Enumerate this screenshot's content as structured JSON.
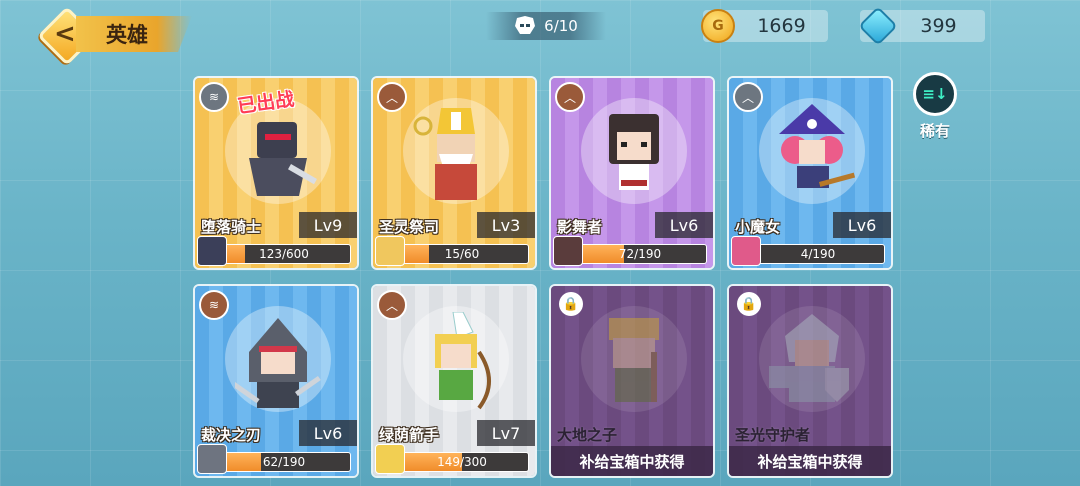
{
  "header": {
    "title": "英雄",
    "hero_count": "6/10"
  },
  "currency": {
    "coins": "1669",
    "coin_symbol": "G",
    "gems": "399"
  },
  "filter": {
    "label": "稀有"
  },
  "heroes": [
    {
      "name": "堕落骑士",
      "level": "Lv9",
      "progress_text": "123/600",
      "progress": 0.205,
      "tag": "已出战",
      "color": "#f5c152"
    },
    {
      "name": "圣灵祭司",
      "level": "Lv3",
      "progress_text": "15/60",
      "progress": 0.25,
      "color": "#f5c152"
    },
    {
      "name": "影舞者",
      "level": "Lv6",
      "progress_text": "72/190",
      "progress": 0.379,
      "color": "#b784e0"
    },
    {
      "name": "小魔女",
      "level": "Lv6",
      "progress_text": "4/190",
      "progress": 0.021,
      "color": "#5aa9e6"
    },
    {
      "name": "裁决之刃",
      "level": "Lv6",
      "progress_text": "62/190",
      "progress": 0.326,
      "color": "#5aa9e6"
    },
    {
      "name": "绿荫箭手",
      "level": "Lv7",
      "progress_text": "149/300",
      "progress": 0.497,
      "color": "#dcdfe3"
    },
    {
      "name": "大地之子",
      "obtain": "补给宝箱中获得",
      "locked": true,
      "color": "#6b4a7e"
    },
    {
      "name": "圣光守护者",
      "obtain": "补给宝箱中获得",
      "locked": true,
      "color": "#6b4a7e"
    }
  ]
}
